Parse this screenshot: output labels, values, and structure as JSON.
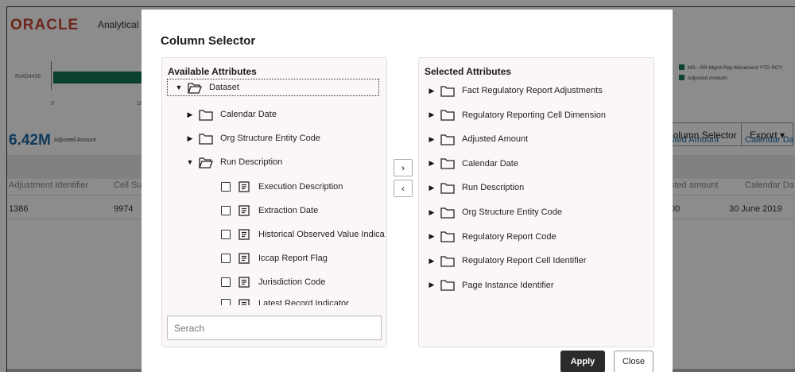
{
  "background": {
    "logo": "ORACLE",
    "app_title": "Analytical",
    "chart": {
      "category": "RIAD4435",
      "ticks": [
        "0",
        "1M"
      ],
      "legend": [
        "MS - RR Mgmt Rep Movement YTD RCY",
        "Adjusted Amount"
      ],
      "legend_colors": [
        "#177b54",
        "#177b54"
      ]
    },
    "kpi": {
      "value": "6.42M",
      "label": "Adjusted Amount"
    },
    "toolbar": {
      "column_selector": "Column Selector",
      "export": "Export"
    },
    "table": {
      "headers_left": [
        "Adjustment Identifier",
        "Cell Su"
      ],
      "headers_right": [
        "sted Amount",
        "Calendar Da"
      ],
      "subheaders_right": [
        "sted amount",
        "Calendar Da"
      ],
      "row_left": [
        "1386",
        "9974"
      ],
      "row_right": [
        "00",
        "30 June 2019"
      ]
    }
  },
  "modal": {
    "title": "Column Selector",
    "available": {
      "title": "Available Attributes",
      "root": "Dataset",
      "folders": [
        "Calendar Date",
        "Org Structure Entity Code",
        "Run Description"
      ],
      "leaves": [
        "Execution Description",
        "Extraction Date",
        "Historical Observed Value Indica",
        "Iccap Report Flag",
        "Jurisdiction Code",
        "Latest Record Indicator"
      ],
      "search_placeholder": "Serach"
    },
    "selected": {
      "title": "Selected Attributes",
      "items": [
        "Fact Regulatory Report Adjustments",
        "Regulatory Reporting Cell Dimension",
        "Adjusted Amount",
        "Calendar Date",
        "Run Description",
        "Org Structure Entity Code",
        "Regulatory Report Code",
        "Regulatory Report Cell Identifier",
        "Page Instance Identifier"
      ]
    },
    "move_right": "›",
    "move_left": "‹",
    "apply": "Apply",
    "close": "Close"
  }
}
